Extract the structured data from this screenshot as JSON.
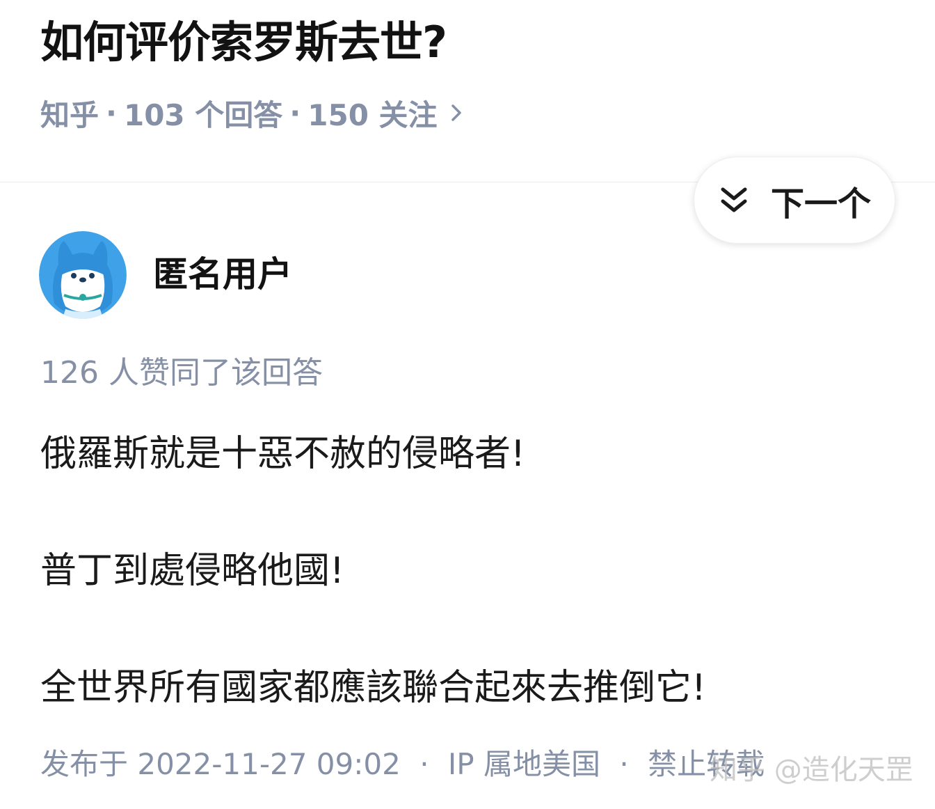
{
  "question": {
    "title": "如何评价索罗斯去世?",
    "source": "知乎",
    "separator": "·",
    "answers_count": "103 个回答",
    "followers_count": "150 关注"
  },
  "next_button": {
    "label": "下一个"
  },
  "author": {
    "name": "匿名用户"
  },
  "answer": {
    "vote_info": "126 人赞同了该回答",
    "paragraphs": [
      "俄羅斯就是十惡不赦的侵略者!",
      "普丁到處侵略他國!",
      "全世界所有國家都應該聯合起來去推倒它!"
    ],
    "published": "发布于 2022-11-27 09:02",
    "ip_location": "IP 属地美国",
    "copyright": "禁止转载",
    "separator": "·"
  },
  "watermark": "知乎 @造化天罡",
  "colors": {
    "meta_gray": "#8590a6",
    "avatar_blue": "#3fa2e8",
    "text_dark": "#121212"
  }
}
